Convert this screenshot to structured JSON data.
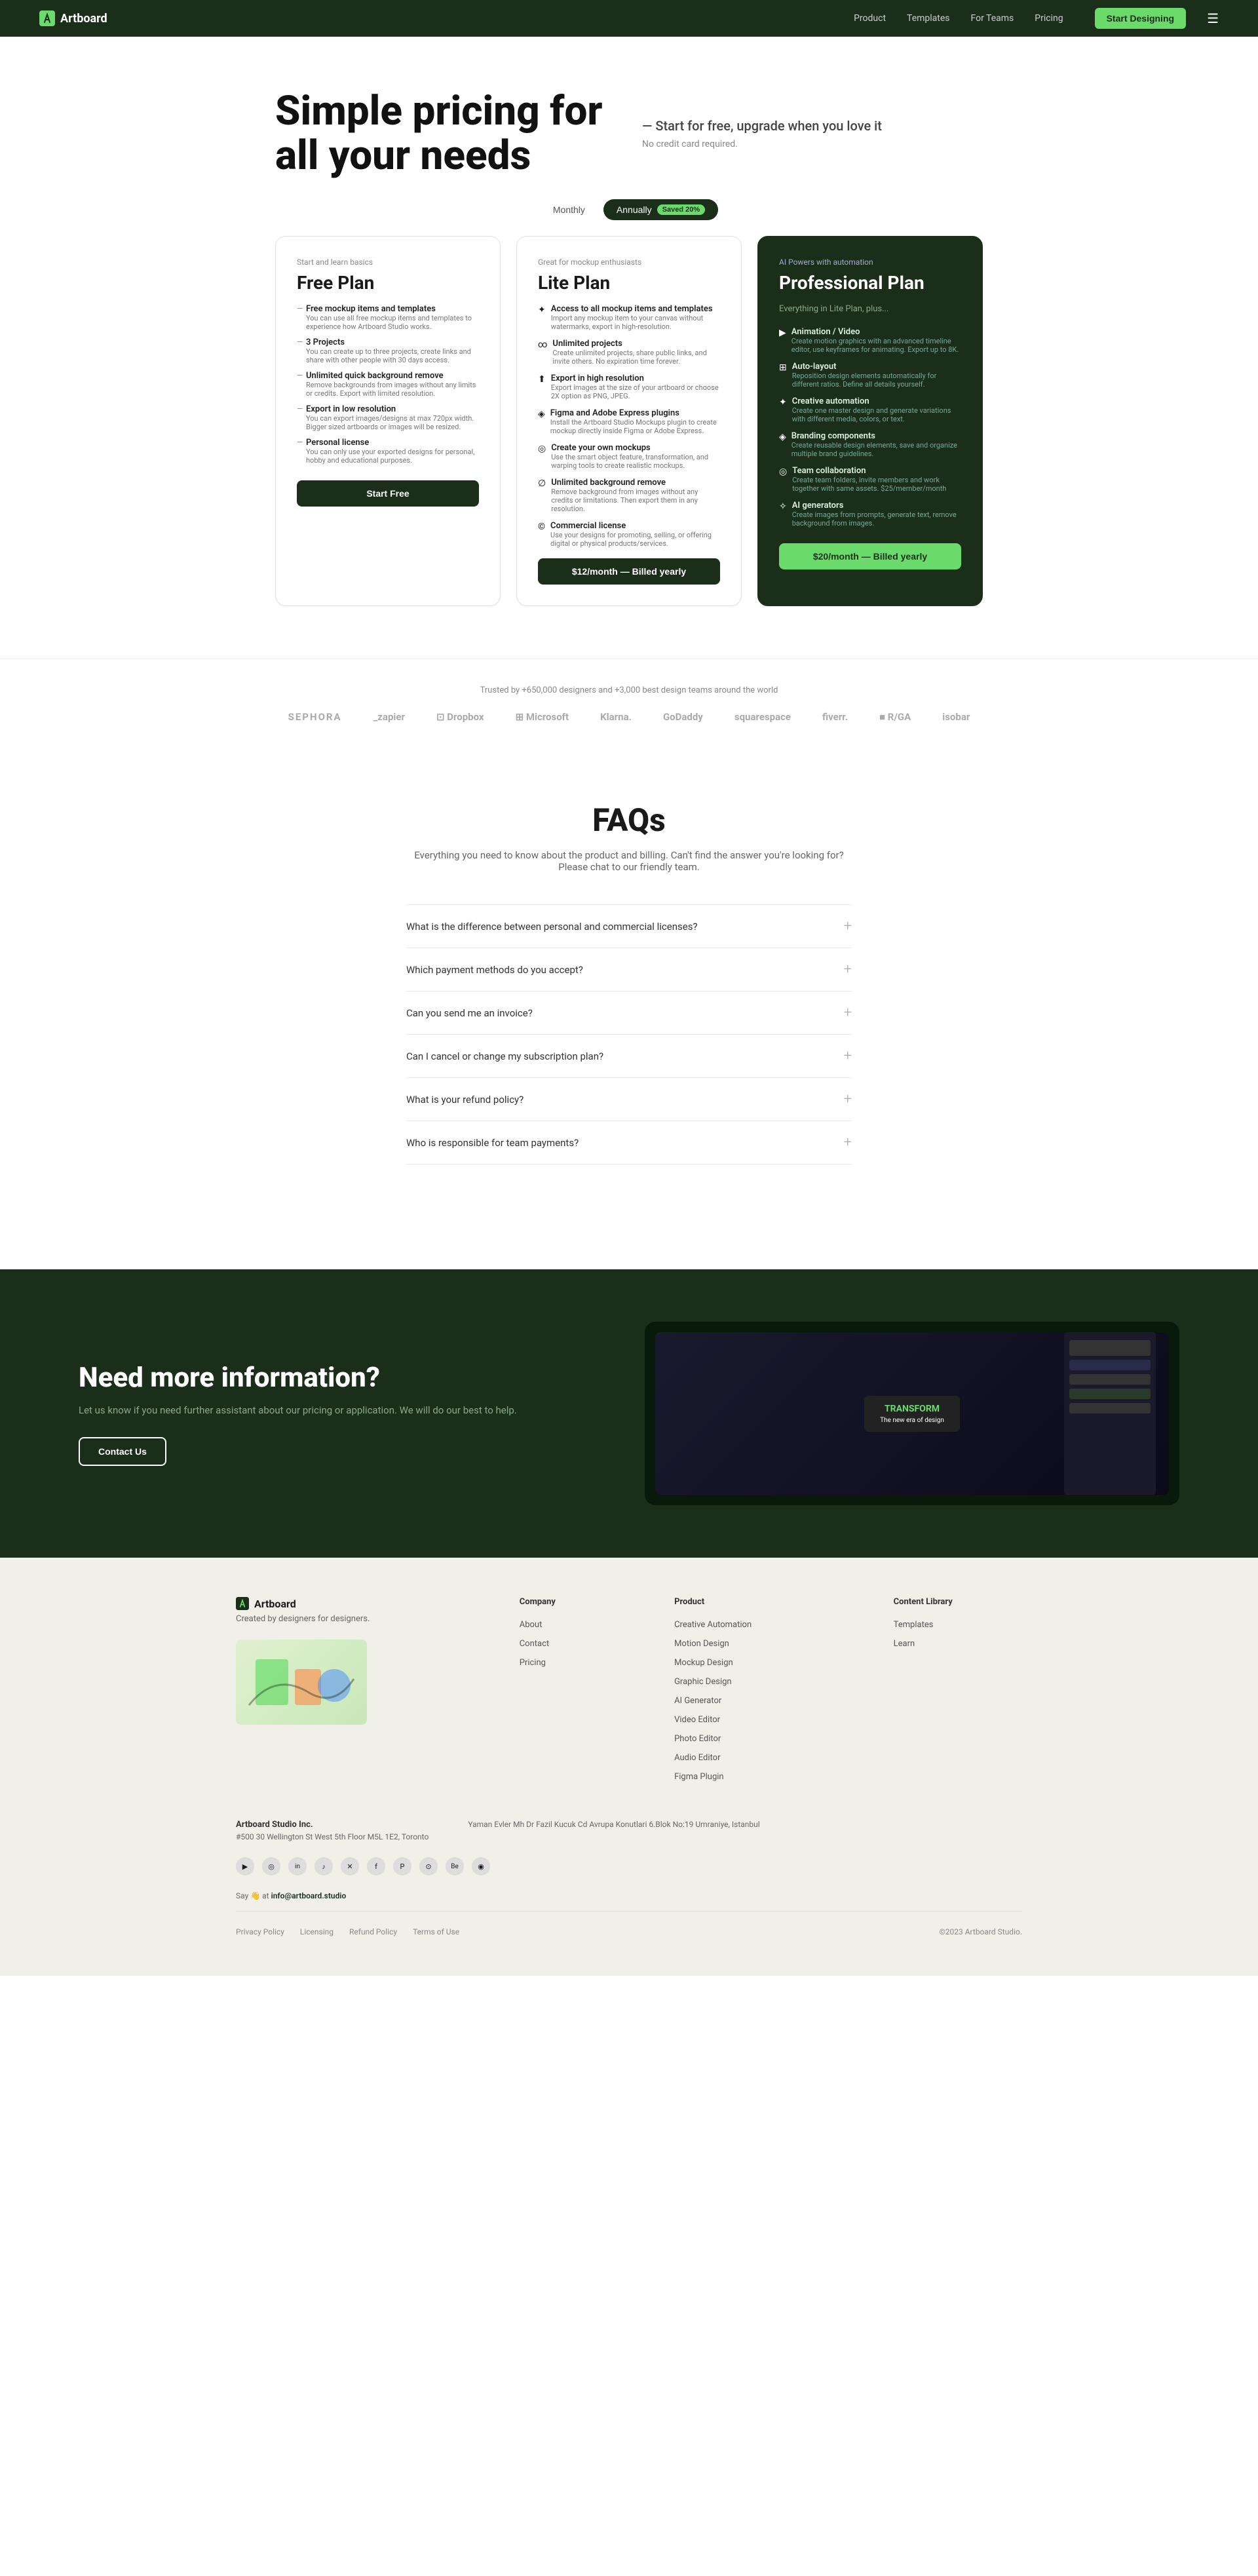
{
  "nav": {
    "logo": "Artboard",
    "links": [
      "Product",
      "Templates",
      "For Teams",
      "Pricing"
    ],
    "cta": "Start Designing"
  },
  "hero": {
    "title": "Simple pricing for all your needs",
    "subtitle": "— Start for free, upgrade when you love it",
    "no_cc": "No credit card required."
  },
  "billing": {
    "monthly": "Monthly",
    "annually": "Annually",
    "badge": "Saved 20%"
  },
  "free_plan": {
    "tag": "Start and learn basics",
    "title": "Free Plan",
    "features": [
      {
        "title": "Free mockup items and templates",
        "desc": "You can use all free mockup items and templates to experience how Artboard Studio works."
      },
      {
        "title": "3 Projects",
        "desc": "You can create up to three projects, create links and share with other people with 30 days access."
      },
      {
        "title": "Unlimited quick background remove",
        "desc": "Remove backgrounds from images without any limits or credits. Export with limited resolution."
      },
      {
        "title": "Export in low resolution",
        "desc": "You can export images/designs at max 720px width. Bigger sized artboards or images will be resized."
      },
      {
        "title": "Personal license",
        "desc": "You can only use your exported designs for personal, hobby and educational purposes."
      }
    ],
    "cta": "Start Free"
  },
  "lite_plan": {
    "tag": "Great for mockup enthusiasts",
    "title": "Lite Plan",
    "features": [
      {
        "icon": "✦",
        "title": "Access to all mockup items and templates",
        "desc": "Import any mockup item to your canvas without watermarks, export in high-resolution."
      },
      {
        "icon": "∞",
        "title": "Unlimited projects",
        "desc": "Create unlimited projects, share public links, and invite others. No expiration time forever."
      },
      {
        "icon": "⬆",
        "title": "Export in high resolution",
        "desc": "Export images at the size of your artboard or choose 2X option as PNG, JPEG."
      },
      {
        "icon": "◈",
        "title": "Figma and Adobe Express plugins",
        "desc": "Install the Artboard Studio Mockups plugin to create mockup directly inside Figma or Adobe Express."
      },
      {
        "icon": "◎",
        "title": "Create your own mockups",
        "desc": "Use the smart object feature, transformation, and warping tools to create realistic mockups."
      },
      {
        "icon": "∅",
        "title": "Unlimited background remove",
        "desc": "Remove background from images without any credits or limitations. Then export them in any resolution."
      },
      {
        "icon": "©",
        "title": "Commercial license",
        "desc": "Use your designs for promoting, selling, or offering digital or physical products/services."
      }
    ],
    "price": "$12/month — Billed yearly",
    "cta": "$12/month — Billed yearly"
  },
  "pro_plan": {
    "tag": "AI Powers with automation",
    "title": "Professional Plan",
    "subtitle": "Everything in Lite Plan, plus...",
    "features": [
      {
        "icon": "▶",
        "title": "Animation / Video",
        "desc": "Create motion graphics with an advanced timeline editor, use keyframes for animating. Export up to 8K."
      },
      {
        "icon": "⊞",
        "title": "Auto-layout",
        "desc": "Reposition design elements automatically for different ratios. Define all details yourself."
      },
      {
        "icon": "✦",
        "title": "Creative automation",
        "desc": "Create one master design and generate variations with different media, colors, or text."
      },
      {
        "icon": "◈",
        "title": "Branding components",
        "desc": "Create reusable design elements, save and organize multiple brand guidelines."
      },
      {
        "icon": "◎",
        "title": "Team collaboration",
        "desc": "Create team folders, invite members and work together with same assets. $25/member/month"
      },
      {
        "icon": "✧",
        "title": "AI generators",
        "desc": "Create images from prompts, generate text, remove background from images."
      }
    ],
    "price": "$20/month — Billed yearly",
    "cta": "$20/month — Billed yearly"
  },
  "trusted": {
    "text": "Trusted by +650,000 designers and +3,000 best design teams around the world",
    "brands": [
      "SEPHORA",
      "_zapier",
      "⊞ Dropbox",
      "⊞ Microsoft",
      "Klarna.",
      "GoDaddy",
      "squarespace",
      "fiverr.",
      "■ R/GA",
      "isobar"
    ]
  },
  "faq": {
    "title": "FAQs",
    "subtitle": "Everything you need to know about the product and billing. Can't find the answer you're looking for? Please chat to our friendly team.",
    "items": [
      "What is the difference between personal and commercial licenses?",
      "Which payment methods do you accept?",
      "Can you send me an invoice?",
      "Can I cancel or change my subscription plan?",
      "What is your refund policy?",
      "Who is responsible for team payments?"
    ]
  },
  "cta_section": {
    "title": "Need more information?",
    "desc": "Let us know if you need further assistant about our pricing or application. We will do our best to help.",
    "button": "Contact Us"
  },
  "footer": {
    "logo": "Artboard",
    "tagline": "Created by designers for designers.",
    "columns": {
      "company": {
        "title": "Company",
        "links": [
          "About",
          "Contact",
          "Pricing"
        ]
      },
      "product": {
        "title": "Product",
        "links": [
          "Creative Automation",
          "Motion Design",
          "Mockup Design",
          "Graphic Design",
          "AI Generator",
          "Video Editor",
          "Photo Editor",
          "Audio Editor",
          "Figma Plugin"
        ]
      },
      "content_library": {
        "title": "Content Library",
        "links": [
          "Templates",
          "Learn"
        ]
      }
    },
    "company_name": "Artboard Studio Inc.",
    "address1": "#500 30 Wellington St West 5th Floor M5L 1E2, Toronto",
    "address2": "Yaman Evler Mh Dr Fazil Kucuk Cd Avrupa Konutlari 6.Blok No:19 Umraniye, Istanbul",
    "say": "Say",
    "email": "info@artboard.studio",
    "legal": [
      "Privacy Policy",
      "Licensing",
      "Refund Policy",
      "Terms of Use"
    ],
    "copyright": "©2023 Artboard Studio."
  }
}
